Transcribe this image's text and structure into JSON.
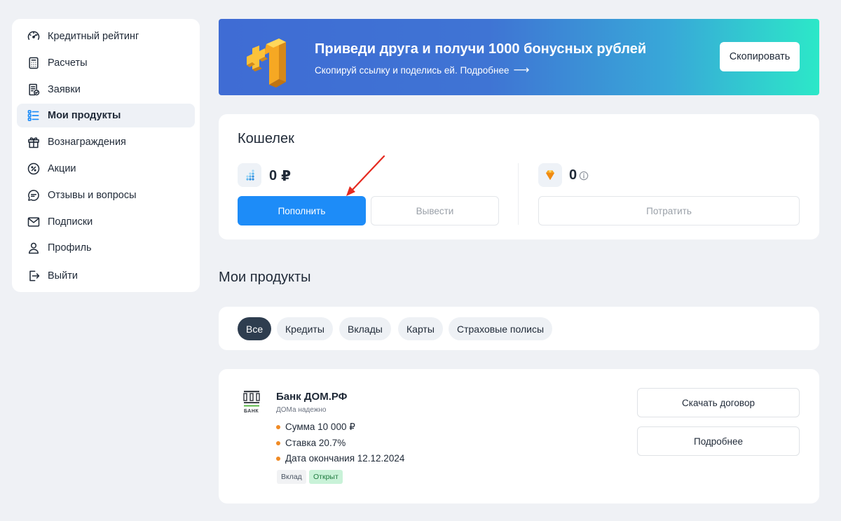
{
  "sidebar": {
    "items": [
      {
        "label": "Кредитный рейтинг",
        "icon": "gauge-icon"
      },
      {
        "label": "Расчеты",
        "icon": "calculator-icon"
      },
      {
        "label": "Заявки",
        "icon": "application-icon"
      },
      {
        "label": "Мои продукты",
        "icon": "products-list-icon",
        "active": true
      },
      {
        "label": "Вознаграждения",
        "icon": "gift-icon"
      },
      {
        "label": "Акции",
        "icon": "percent-icon"
      },
      {
        "label": "Отзывы и вопросы",
        "icon": "chat-icon"
      },
      {
        "label": "Подписки",
        "icon": "mail-icon"
      },
      {
        "label": "Профиль",
        "icon": "user-icon"
      },
      {
        "label": "Выйти",
        "icon": "logout-icon"
      }
    ]
  },
  "banner": {
    "title": "Приведи друга и получи 1000 бонусных рублей",
    "subtitle": "Скопируй ссылку и поделись ей. Подробнее",
    "copy_label": "Скопировать",
    "gradient_start": "#3f6cd4",
    "gradient_end": "#2ce8c8"
  },
  "wallet": {
    "title": "Кошелек",
    "rub_balance": "0",
    "rub_currency": "₽",
    "bonus_balance": "0",
    "topup_label": "Пополнить",
    "withdraw_label": "Вывести",
    "spend_label": "Потратить",
    "accent": "#1d8cf8"
  },
  "products_section": {
    "title": "Мои продукты",
    "filters": [
      "Все",
      "Кредиты",
      "Вклады",
      "Карты",
      "Страховые полисы"
    ],
    "active_filter": "Все"
  },
  "product": {
    "bank_name": "Банк ДОМ.РФ",
    "slogan": "ДОМа надежно",
    "details": [
      "Сумма 10 000 ₽",
      "Ставка 20.7%",
      "Дата окончания 12.12.2024"
    ],
    "tags": {
      "type": "Вклад",
      "status": "Открыт"
    },
    "download_label": "Скачать договор",
    "more_label": "Подробнее",
    "logo_text": "БАНК"
  }
}
